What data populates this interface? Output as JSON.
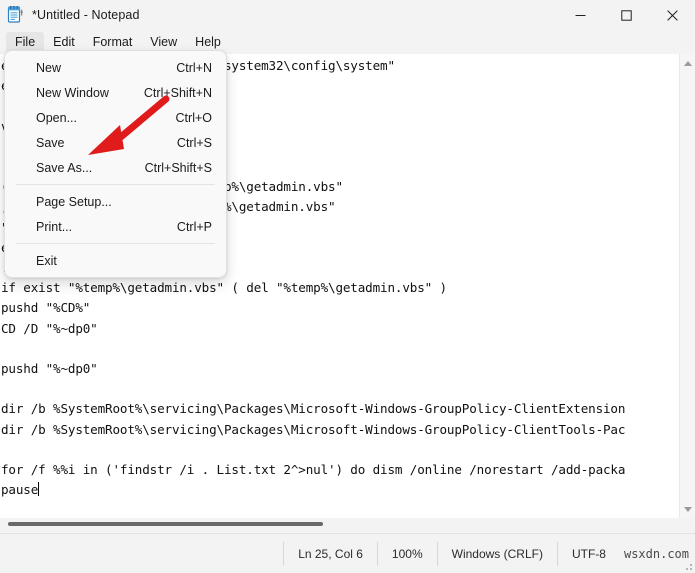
{
  "window": {
    "title": "*Untitled - Notepad",
    "icon": "notepad-icon",
    "controls": {
      "minimize": "minimize-icon",
      "maximize": "maximize-icon",
      "close": "close-icon"
    }
  },
  "menubar": {
    "items": [
      {
        "label": "File",
        "active": true
      },
      {
        "label": "Edit",
        "active": false
      },
      {
        "label": "Format",
        "active": false
      },
      {
        "label": "View",
        "active": false
      },
      {
        "label": "Help",
        "active": false
      }
    ]
  },
  "file_menu": {
    "items": [
      {
        "label": "New",
        "accel": "Ctrl+N",
        "separator_after": false
      },
      {
        "label": "New Window",
        "accel": "Ctrl+Shift+N",
        "separator_after": false
      },
      {
        "label": "Open...",
        "accel": "Ctrl+O",
        "separator_after": false
      },
      {
        "label": "Save",
        "accel": "Ctrl+S",
        "separator_after": false
      },
      {
        "label": "Save As...",
        "accel": "Ctrl+Shift+S",
        "separator_after": true
      },
      {
        "label": "Page Setup...",
        "accel": "",
        "separator_after": false
      },
      {
        "label": "Print...",
        "accel": "Ctrl+P",
        "separator_after": true
      },
      {
        "label": "Exit",
        "accel": "",
        "separator_after": false
      }
    ]
  },
  "annotation": {
    "type": "red-arrow",
    "color": "#e01b1b",
    "points_to": "Save As..."
  },
  "editor": {
    "text": "em32\\cacls.exe\" \"%SYSTEMROOT%\\system32\\config\\system\"\ne do not have admin.\n\nve privileges...\n\n\n(\"Shell.Application\"^) > \"%temp%\\getadmin.vbs\"\n, \"\", \"\", \"runas\", 1 >> \"%temp%\\getadmin.vbs\"\n\"%temp%\\getadmin.vbs\"\nexit /B\n:gotAdmin\nif exist \"%temp%\\getadmin.vbs\" ( del \"%temp%\\getadmin.vbs\" )\npushd \"%CD%\"\nCD /D \"%~dp0\"\n\npushd \"%~dp0\"\n\ndir /b %SystemRoot%\\servicing\\Packages\\Microsoft-Windows-GroupPolicy-ClientExtension\ndir /b %SystemRoot%\\servicing\\Packages\\Microsoft-Windows-GroupPolicy-ClientTools-Pac\n\nfor /f %%i in ('findstr /i . List.txt 2^>nul') do dism /online /norestart /add-packa\npause",
    "caret_line": "pause"
  },
  "scrollbars": {
    "vertical": {
      "up_arrow": "scroll-up-icon",
      "down_arrow": "scroll-down-icon"
    },
    "horizontal": {
      "thumb": true
    }
  },
  "statusbar": {
    "cells": [
      {
        "label": "Ln 25, Col 6"
      },
      {
        "label": "100%"
      },
      {
        "label": "Windows (CRLF)"
      },
      {
        "label": "UTF-8"
      }
    ],
    "watermark": "wsxdn.com"
  }
}
